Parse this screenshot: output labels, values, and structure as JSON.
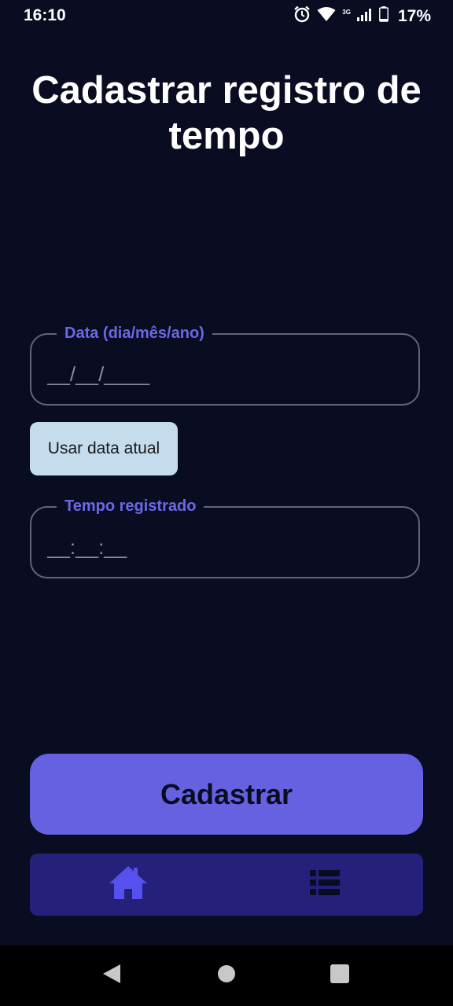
{
  "status_bar": {
    "time": "16:10",
    "network": "3G",
    "battery": "17%"
  },
  "page": {
    "title": "Cadastrar registro de tempo"
  },
  "form": {
    "date_label": "Data (dia/mês/ano)",
    "date_placeholder": "__/__/____",
    "use_today_label": "Usar data atual",
    "time_label": "Tempo registrado",
    "time_placeholder": "__:__:__",
    "submit_label": "Cadastrar"
  },
  "tabs": [
    {
      "icon": "home-icon",
      "active": true
    },
    {
      "icon": "list-icon",
      "active": false
    }
  ],
  "colors": {
    "background": "#0a0d21",
    "accent": "#6661e0",
    "label": "#6b68e6",
    "tab_bar": "#25217a",
    "secondary_button": "#c4dcec"
  }
}
